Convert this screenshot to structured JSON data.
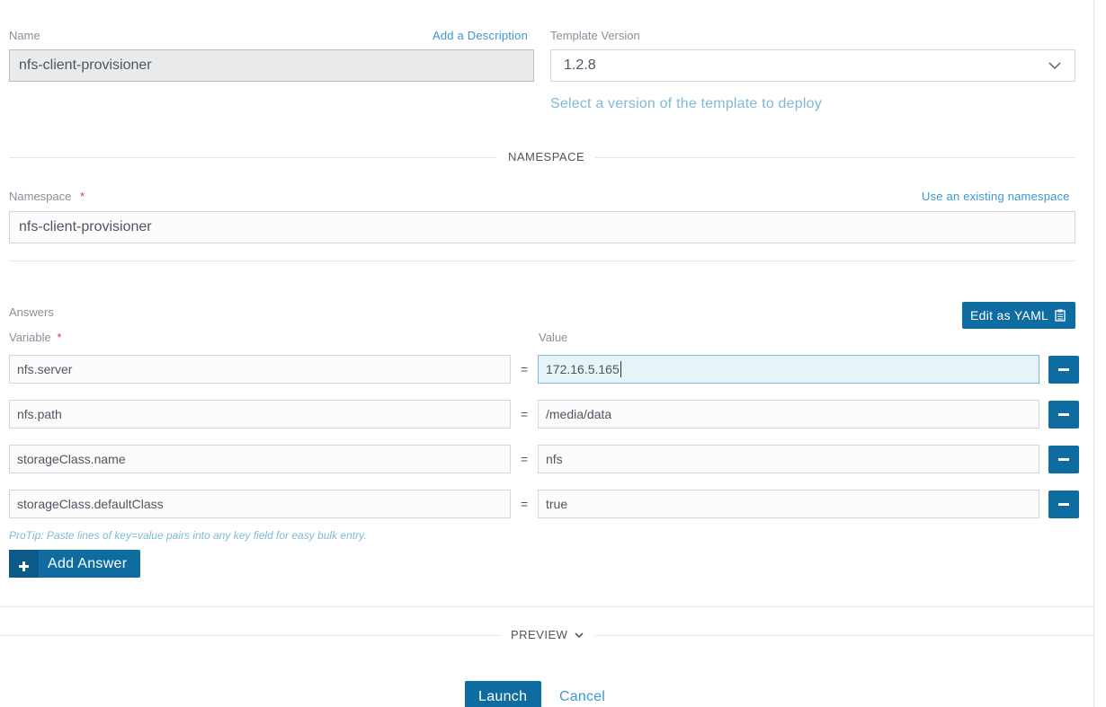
{
  "name": {
    "label": "Name",
    "add_description": "Add a Description",
    "value": "nfs-client-provisioner"
  },
  "template_version": {
    "label": "Template Version",
    "selected": "1.2.8",
    "help": "Select a version of the template to deploy"
  },
  "namespace_section": {
    "title": "NAMESPACE",
    "label": "Namespace",
    "required_mark": "*",
    "use_existing": "Use an existing namespace",
    "value": "nfs-client-provisioner"
  },
  "answers": {
    "title": "Answers",
    "edit_yaml": "Edit as YAML",
    "variable_label": "Variable",
    "required_mark": "*",
    "value_label": "Value",
    "equals": "=",
    "rows": [
      {
        "key": "nfs.server",
        "value": "172.16.5.165"
      },
      {
        "key": "nfs.path",
        "value": "/media/data"
      },
      {
        "key": "storageClass.name",
        "value": "nfs"
      },
      {
        "key": "storageClass.defaultClass",
        "value": "true"
      }
    ],
    "protip": "ProTip: Paste lines of key=value pairs into any key field for easy bulk entry.",
    "add_answer": "Add Answer"
  },
  "preview": {
    "label": "PREVIEW"
  },
  "footer": {
    "launch": "Launch",
    "cancel": "Cancel"
  },
  "colors": {
    "accent": "#0f6ca1",
    "link": "#3d98d3",
    "required": "#e3393b"
  },
  "icons": [
    "chevron-down-icon",
    "clipboard-icon",
    "minus-icon",
    "plus-icon"
  ]
}
